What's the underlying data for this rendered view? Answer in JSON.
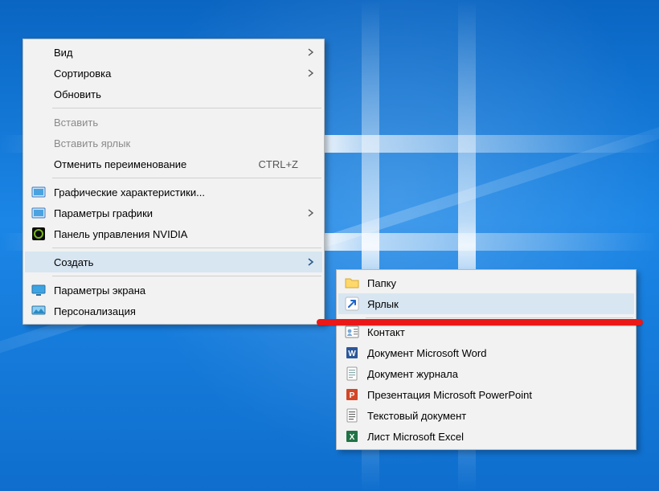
{
  "menu1": {
    "items": {
      "view": {
        "label": "Вид"
      },
      "sort": {
        "label": "Сортировка"
      },
      "refresh": {
        "label": "Обновить"
      },
      "paste": {
        "label": "Вставить"
      },
      "paste_link": {
        "label": "Вставить ярлык"
      },
      "undo": {
        "label": "Отменить переименование",
        "accel": "CTRL+Z"
      },
      "intel_props": {
        "label": "Графические характеристики..."
      },
      "intel_gfx": {
        "label": "Параметры графики"
      },
      "nvidia": {
        "label": "Панель управления NVIDIA"
      },
      "create": {
        "label": "Создать"
      },
      "display": {
        "label": "Параметры экрана"
      },
      "personalize": {
        "label": "Персонализация"
      }
    }
  },
  "menu2": {
    "items": {
      "folder": {
        "label": "Папку"
      },
      "shortcut": {
        "label": "Ярлык"
      },
      "contact": {
        "label": "Контакт"
      },
      "word": {
        "label": "Документ Microsoft Word"
      },
      "journal": {
        "label": "Документ журнала"
      },
      "ppt": {
        "label": "Презентация Microsoft PowerPoint"
      },
      "txt": {
        "label": "Текстовый документ"
      },
      "xls": {
        "label": "Лист Microsoft Excel"
      }
    }
  }
}
